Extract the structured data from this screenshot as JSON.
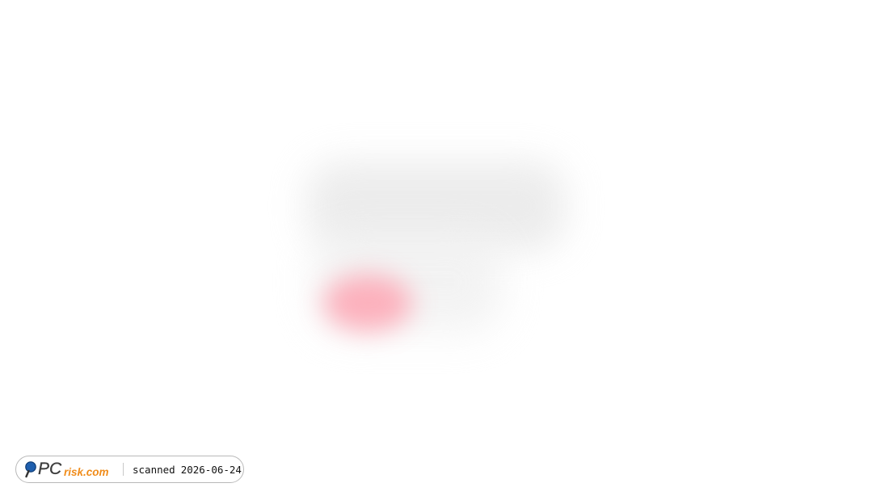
{
  "watermark": {
    "logo": {
      "icon": "magnifier-icon",
      "brand_primary": "PC",
      "brand_secondary": "risk.com",
      "colors": {
        "primary": "#3d3d3d",
        "secondary": "#f08c1a",
        "icon": "#1f5fae"
      }
    },
    "scanned_label": "scanned",
    "scanned_date": "2026-06-24"
  },
  "content": {
    "state": "blurred",
    "colors": {
      "gray": "#e9e9e9",
      "pink": "#ff9aaa"
    }
  }
}
